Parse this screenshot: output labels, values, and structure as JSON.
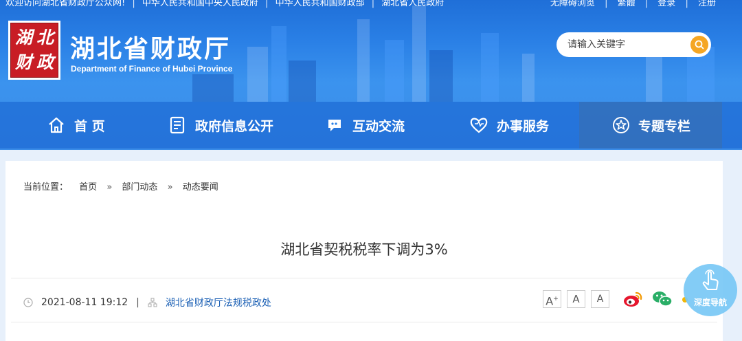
{
  "topbar": {
    "welcome": "欢迎访问湖北省财政厅公众网!",
    "link_central": "中华人民共和国中央人民政府",
    "link_mof": "中华人民共和国财政部",
    "link_hubei": "湖北省人民政府",
    "accessibility": "无障碍浏览",
    "traditional": "繁體",
    "login": "登录",
    "register": "注册"
  },
  "logo": {
    "chars": [
      "湖",
      "北",
      "财",
      "政"
    ]
  },
  "site": {
    "title": "湖北省财政厅",
    "subtitle": "Department of Finance of Hubei Province"
  },
  "search": {
    "placeholder": "请输入关键字"
  },
  "nav": {
    "items": [
      {
        "label": "首 页",
        "icon": "home-icon"
      },
      {
        "label": "政府信息公开",
        "icon": "document-icon"
      },
      {
        "label": "互动交流",
        "icon": "chat-icon"
      },
      {
        "label": "办事服务",
        "icon": "heart-icon"
      },
      {
        "label": "专题专栏",
        "icon": "star-icon",
        "active": true
      }
    ]
  },
  "breadcrumb": {
    "prefix": "当前位置：",
    "items": [
      "首页",
      "部门动态",
      "动态要闻"
    ],
    "separator": "»"
  },
  "article": {
    "title": "湖北省契税税率下调为3%",
    "datetime": "2021-08-11 19:12",
    "source": "湖北省财政厅法规税政处"
  },
  "font_controls": {
    "large": "A",
    "medium": "A",
    "small": "A",
    "large_sup": "+"
  },
  "floating_nav": {
    "label": "深度导航"
  },
  "colors": {
    "header_blue": "#2a80e6",
    "accent_orange": "#f5a623",
    "seal_red": "#c81d25",
    "link_blue": "#1a5fb4"
  }
}
